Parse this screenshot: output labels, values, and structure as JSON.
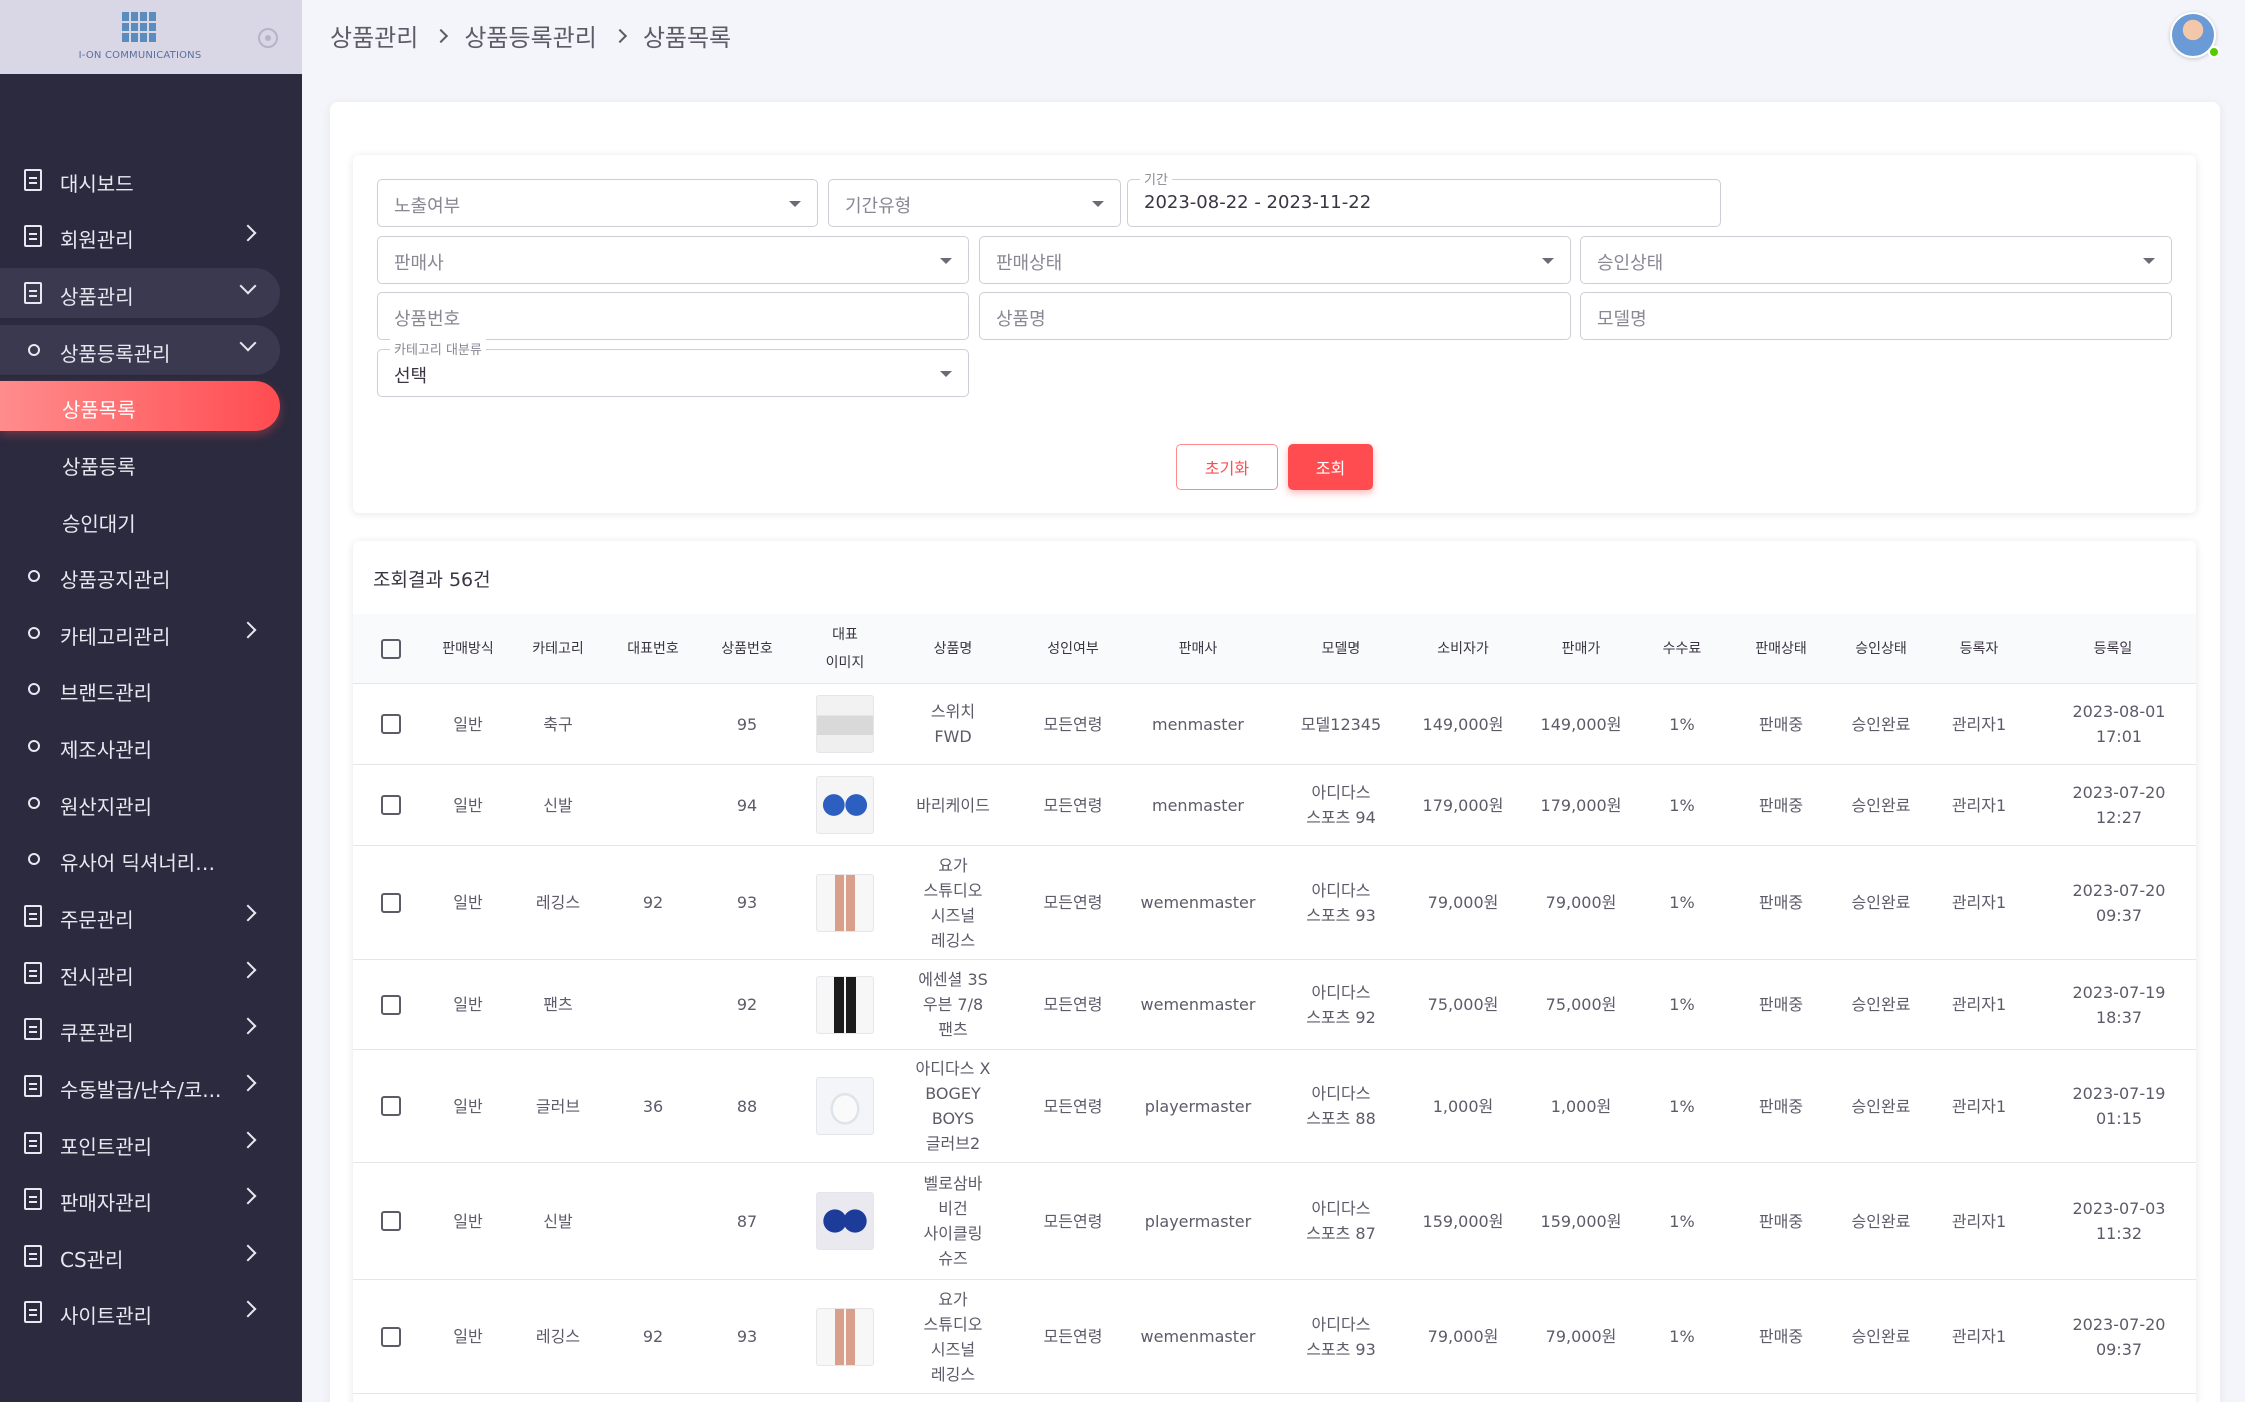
{
  "sidebar": {
    "logo_text": "I-ON COMMUNICATIONS",
    "items": [
      {
        "label": "대시보드",
        "type": "page"
      },
      {
        "label": "회원관리",
        "type": "page",
        "chevron": "right"
      },
      {
        "label": "상품관리",
        "type": "page",
        "chevron": "down",
        "state": "open"
      },
      {
        "label": "상품등록관리",
        "type": "group",
        "chevron": "down",
        "state": "open"
      },
      {
        "label": "상품목록",
        "type": "leaf",
        "state": "active"
      },
      {
        "label": "상품등록",
        "type": "leaf"
      },
      {
        "label": "승인대기",
        "type": "leaf"
      },
      {
        "label": "상품공지관리",
        "type": "group"
      },
      {
        "label": "카테고리관리",
        "type": "group",
        "chevron": "right"
      },
      {
        "label": "브랜드관리",
        "type": "group"
      },
      {
        "label": "제조사관리",
        "type": "group"
      },
      {
        "label": "원산지관리",
        "type": "group"
      },
      {
        "label": "유사어 딕셔너리관리",
        "type": "group"
      },
      {
        "label": "주문관리",
        "type": "page",
        "chevron": "right"
      },
      {
        "label": "전시관리",
        "type": "page",
        "chevron": "right"
      },
      {
        "label": "쿠폰관리",
        "type": "page",
        "chevron": "right"
      },
      {
        "label": "수동발급/난수/코...",
        "type": "page",
        "chevron": "right"
      },
      {
        "label": "포인트관리",
        "type": "page",
        "chevron": "right"
      },
      {
        "label": "판매자관리",
        "type": "page",
        "chevron": "right"
      },
      {
        "label": "CS관리",
        "type": "page",
        "chevron": "right"
      },
      {
        "label": "사이트관리",
        "type": "page",
        "chevron": "right"
      }
    ]
  },
  "breadcrumb": [
    "상품관리",
    "상품등록관리",
    "상품목록"
  ],
  "filters": {
    "exposure": {
      "placeholder": "노출여부"
    },
    "period_type": {
      "placeholder": "기간유형"
    },
    "period": {
      "label": "기간",
      "value": "2023-08-22 - 2023-11-22"
    },
    "seller": {
      "placeholder": "판매사"
    },
    "sale_status": {
      "placeholder": "판매상태"
    },
    "approval_status": {
      "placeholder": "승인상태"
    },
    "product_no": {
      "placeholder": "상품번호"
    },
    "product_name": {
      "placeholder": "상품명"
    },
    "model_name": {
      "placeholder": "모델명"
    },
    "category": {
      "label": "카테고리 대분류",
      "value": "선택"
    },
    "reset_label": "초기화",
    "search_label": "조회"
  },
  "results": {
    "count_label": "조회결과 56건",
    "columns": [
      "판매방식",
      "카테고리",
      "대표번호",
      "상품번호",
      "대표\n이미지",
      "상품명",
      "성인여부",
      "판매사",
      "모델명",
      "소비자가",
      "판매가",
      "수수료",
      "판매상태",
      "승인상태",
      "등록자",
      "등록일"
    ],
    "rows": [
      {
        "method": "일반",
        "category": "축구",
        "rep_no": "",
        "product_no": "95",
        "image": "shoe-white",
        "name": "스위치\nFWD",
        "adult": "모든연령",
        "seller": "menmaster",
        "model": "모델12345",
        "consumer_price": "149,000원",
        "sale_price": "149,000원",
        "fee": "1%",
        "sale_status": "판매중",
        "approval": "승인완료",
        "registrant": "관리자1",
        "date": "2023-08-01 17:01"
      },
      {
        "method": "일반",
        "category": "신발",
        "rep_no": "",
        "product_no": "94",
        "image": "shoe-blue",
        "name": "바리케이드",
        "adult": "모든연령",
        "seller": "menmaster",
        "model": "아디다스\n스포츠 94",
        "consumer_price": "179,000원",
        "sale_price": "179,000원",
        "fee": "1%",
        "sale_status": "판매중",
        "approval": "승인완료",
        "registrant": "관리자1",
        "date": "2023-07-20 12:27"
      },
      {
        "method": "일반",
        "category": "레깅스",
        "rep_no": "92",
        "product_no": "93",
        "image": "leggings",
        "name": "요가\n스튜디오\n시즈널\n레깅스",
        "adult": "모든연령",
        "seller": "wemenmaster",
        "model": "아디다스\n스포츠 93",
        "consumer_price": "79,000원",
        "sale_price": "79,000원",
        "fee": "1%",
        "sale_status": "판매중",
        "approval": "승인완료",
        "registrant": "관리자1",
        "date": "2023-07-20 09:37"
      },
      {
        "method": "일반",
        "category": "팬츠",
        "rep_no": "",
        "product_no": "92",
        "image": "pants",
        "name": "에센셜 3S\n우븐 7/8\n팬츠",
        "adult": "모든연령",
        "seller": "wemenmaster",
        "model": "아디다스\n스포츠 92",
        "consumer_price": "75,000원",
        "sale_price": "75,000원",
        "fee": "1%",
        "sale_status": "판매중",
        "approval": "승인완료",
        "registrant": "관리자1",
        "date": "2023-07-19 18:37"
      },
      {
        "method": "일반",
        "category": "글러브",
        "rep_no": "36",
        "product_no": "88",
        "image": "glove",
        "name": "아디다스 X\nBOGEY\nBOYS\n글러브2",
        "adult": "모든연령",
        "seller": "playermaster",
        "model": "아디다스\n스포츠 88",
        "consumer_price": "1,000원",
        "sale_price": "1,000원",
        "fee": "1%",
        "sale_status": "판매중",
        "approval": "승인완료",
        "registrant": "관리자1",
        "date": "2023-07-19 01:15"
      },
      {
        "method": "일반",
        "category": "신발",
        "rep_no": "",
        "product_no": "87",
        "image": "shoe-navy",
        "name": "벨로삼바\n비건\n사이클링\n슈즈",
        "adult": "모든연령",
        "seller": "playermaster",
        "model": "아디다스\n스포츠 87",
        "consumer_price": "159,000원",
        "sale_price": "159,000원",
        "fee": "1%",
        "sale_status": "판매중",
        "approval": "승인완료",
        "registrant": "관리자1",
        "date": "2023-07-03 11:32"
      },
      {
        "method": "일반",
        "category": "레깅스",
        "rep_no": "92",
        "product_no": "93",
        "image": "leggings",
        "name": "요가\n스튜디오\n시즈널\n레깅스",
        "adult": "모든연령",
        "seller": "wemenmaster",
        "model": "아디다스\n스포츠 93",
        "consumer_price": "79,000원",
        "sale_price": "79,000원",
        "fee": "1%",
        "sale_status": "판매중",
        "approval": "승인완료",
        "registrant": "관리자1",
        "date": "2023-07-20 09:37"
      }
    ]
  },
  "colors": {
    "accent": "#ff4c51",
    "sidebar_bg": "#2b2a3f"
  }
}
